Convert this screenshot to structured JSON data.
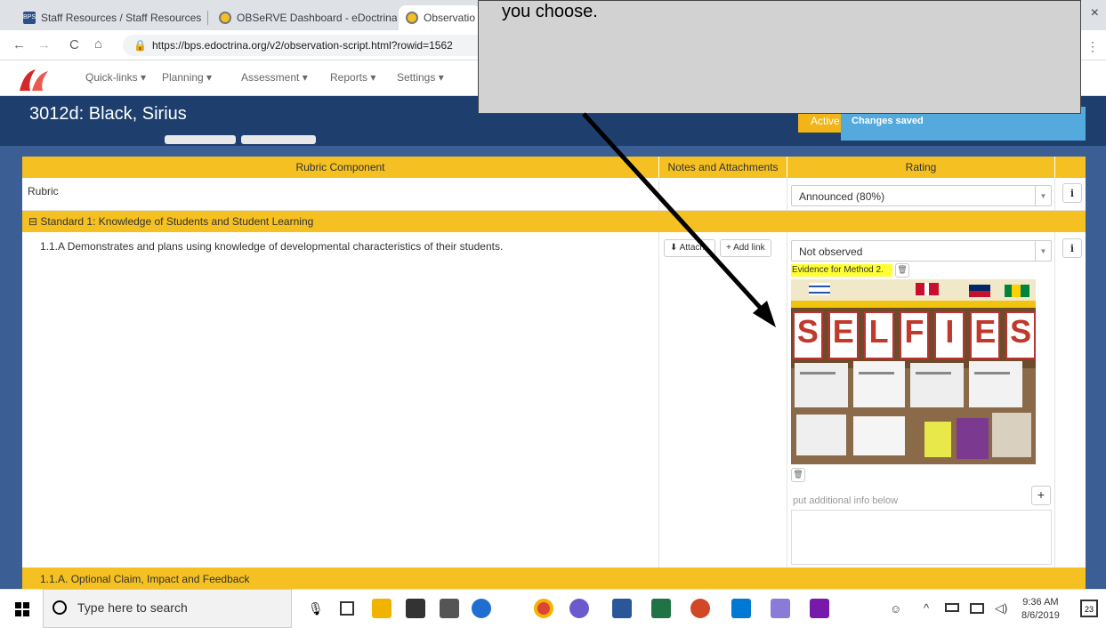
{
  "browser": {
    "tabs": [
      {
        "label": "Staff Resources / Staff Resources",
        "close": "×"
      },
      {
        "label": "OBSeRVE Dashboard - eDoctrina",
        "close": "×"
      },
      {
        "label": "Observatio",
        "close": ""
      }
    ],
    "tab_bps_badge": "BPS",
    "window_close": "×",
    "back": "←",
    "forward": "→",
    "reload": "C",
    "home": "⌂",
    "url": "https://bps.edoctrina.org/v2/observation-script.html?rowid=1562",
    "menu": "⋮"
  },
  "app": {
    "nav": [
      "Quick-links ▾",
      "Planning ▾",
      "Assessment ▾",
      "Reports ▾",
      "Settings ▾"
    ],
    "title": "3012d: Black, Sirius",
    "status_badge": "Active",
    "toast": "Changes saved"
  },
  "table": {
    "headers": [
      "Rubric Component",
      "Notes and Attachments",
      "Rating"
    ],
    "rubric_label": "Rubric",
    "rubric_rating": "Announced (80%)",
    "info_label": "i",
    "section_title": "⊟ Standard 1: Knowledge of Students and Student Learning",
    "component_text": "1.1.A Demonstrates and plans using knowledge of developmental characteristics of their students.",
    "attach_label": "⬇ Attach",
    "add_link_label": "+ Add link",
    "component_rating": "Not observed",
    "evidence_label": "Evidence for Method 2.",
    "additional_info_placeholder": "put additional info below",
    "optional_row": "1.1.A. Optional Claim, Impact and Feedback"
  },
  "callout": {
    "text": "you choose."
  },
  "photo": {
    "letters": [
      "S",
      "E",
      "L",
      "F",
      "I",
      "E",
      "S"
    ]
  },
  "taskbar": {
    "search_placeholder": "Type here to search",
    "time": "9:36 AM",
    "date": "8/6/2019",
    "notifications": "23"
  },
  "colors": {
    "header_blue": "#1e3f6e",
    "rubric_yellow": "#f5c022",
    "toast_blue": "#55aadd",
    "evidence_highlight": "#ffff33"
  }
}
